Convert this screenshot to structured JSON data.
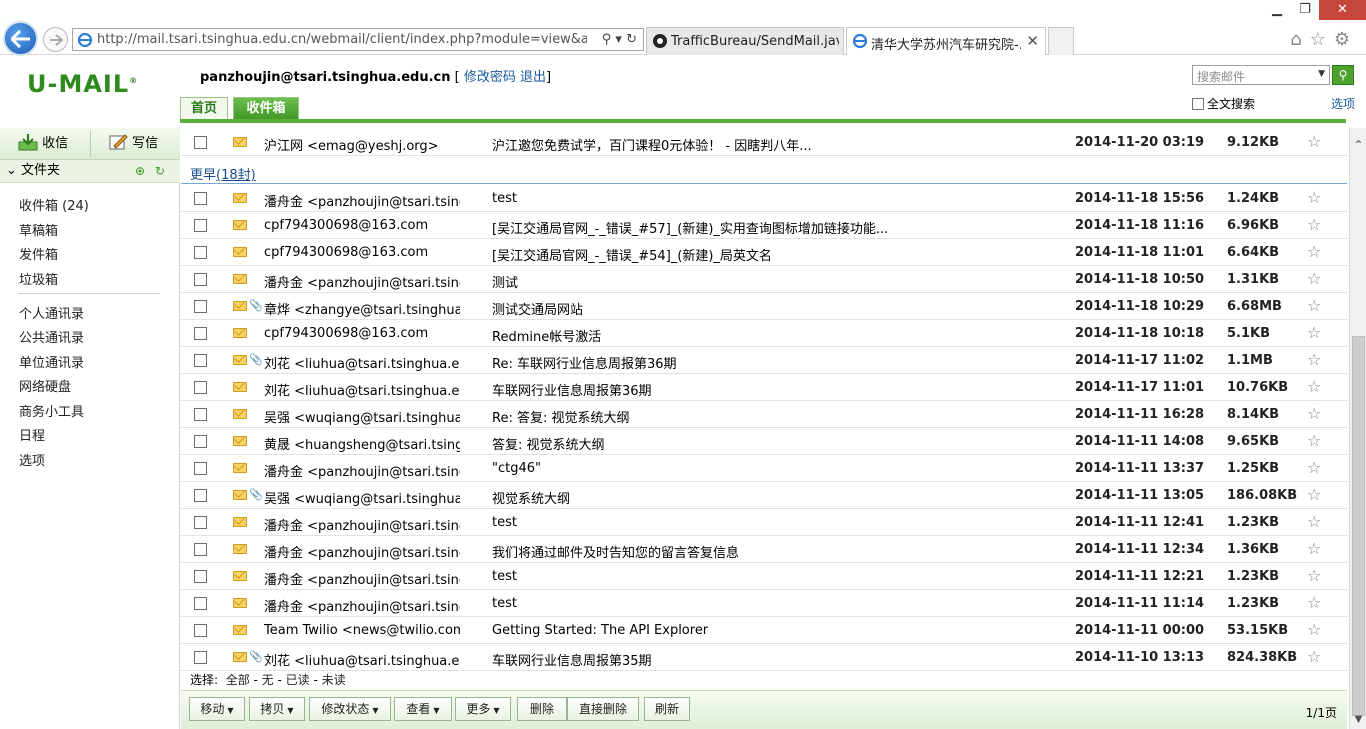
{
  "browser": {
    "url": "http://mail.tsari.tsinghua.edu.cn/webmail/client/index.php?module=view&action=ir",
    "tabs": [
      {
        "label": "TrafficBureau/SendMail.jav..."
      },
      {
        "label": "清华大学苏州汽车研究院-..."
      }
    ]
  },
  "header": {
    "logo": "U-MAIL",
    "user_email": "panzhoujin@tsari.tsinghua.edu.cn",
    "change_password": "修改密码",
    "logout": "退出",
    "tabs": {
      "home": "首页",
      "inbox": "收件箱"
    },
    "search_placeholder": "搜索邮件",
    "fulltext_label": "全文搜索",
    "options_link": "选项"
  },
  "sidebar": {
    "receive": "收信",
    "write": "写信",
    "folders_title": "文件夹",
    "folders": [
      "收件箱 (24)",
      "草稿箱",
      "发件箱",
      "垃圾箱"
    ],
    "tools": [
      "个人通讯录",
      "公共通讯录",
      "单位通讯录",
      "网络硬盘",
      "商务小工具",
      "日程",
      "选项"
    ]
  },
  "list": {
    "top_row": {
      "from": "沪江网 <emag@yeshj.org>",
      "subject": "沪江邀您免费试学，百门课程0元体验！ - 因瞎判八年...",
      "date": "2014-11-20 03:19",
      "size": "9.12KB"
    },
    "group_label": "更早",
    "group_count": "(18封)",
    "rows": [
      {
        "from": "潘舟金 <panzhoujin@tsari.tsinghua",
        "subject": "test",
        "date": "2014-11-18 15:56",
        "size": "1.24KB",
        "attach": false
      },
      {
        "from": "cpf794300698@163.com",
        "subject": "[吴江交通局官网_-_错误_#57]_(新建)_实用查询图标增加链接功能...",
        "date": "2014-11-18 11:16",
        "size": "6.96KB",
        "attach": false
      },
      {
        "from": "cpf794300698@163.com",
        "subject": "[吴江交通局官网_-_错误_#54]_(新建)_局英文名",
        "date": "2014-11-18 11:01",
        "size": "6.64KB",
        "attach": false
      },
      {
        "from": "潘舟金 <panzhoujin@tsari.tsinghua",
        "subject": "测试",
        "date": "2014-11-18 10:50",
        "size": "1.31KB",
        "attach": false
      },
      {
        "from": "章烨 <zhangye@tsari.tsinghua.edu",
        "subject": "测试交通局网站",
        "date": "2014-11-18 10:29",
        "size": "6.68MB",
        "attach": true
      },
      {
        "from": "cpf794300698@163.com",
        "subject": "Redmine帐号激活",
        "date": "2014-11-18 10:18",
        "size": "5.1KB",
        "attach": false
      },
      {
        "from": "刘花 <liuhua@tsari.tsinghua.edu",
        "subject": "Re: 车联网行业信息周报第36期",
        "date": "2014-11-17 11:02",
        "size": "1.1MB",
        "attach": true
      },
      {
        "from": "刘花 <liuhua@tsari.tsinghua.edu",
        "subject": "车联网行业信息周报第36期",
        "date": "2014-11-17 11:01",
        "size": "10.76KB",
        "attach": false
      },
      {
        "from": "吴强 <wuqiang@tsari.tsinghua.e",
        "subject": "Re: 答复: 视觉系统大纲",
        "date": "2014-11-11 16:28",
        "size": "8.14KB",
        "attach": false
      },
      {
        "from": "黄晟 <huangsheng@tsari.tsinghu",
        "subject": "答复: 视觉系统大纲",
        "date": "2014-11-11 14:08",
        "size": "9.65KB",
        "attach": false
      },
      {
        "from": "潘舟金 <panzhoujin@tsari.tsinghua",
        "subject": "\"ctg46\"",
        "date": "2014-11-11 13:37",
        "size": "1.25KB",
        "attach": false
      },
      {
        "from": "吴强 <wuqiang@tsari.tsinghua.e",
        "subject": "视觉系统大纲",
        "date": "2014-11-11 13:05",
        "size": "186.08KB",
        "attach": true
      },
      {
        "from": "潘舟金 <panzhoujin@tsari.tsinghua",
        "subject": "test",
        "date": "2014-11-11 12:41",
        "size": "1.23KB",
        "attach": false
      },
      {
        "from": "潘舟金 <panzhoujin@tsari.tsinghua",
        "subject": "我们将通过邮件及时告知您的留言答复信息",
        "date": "2014-11-11 12:34",
        "size": "1.36KB",
        "attach": false
      },
      {
        "from": "潘舟金 <panzhoujin@tsari.tsinghua",
        "subject": "test",
        "date": "2014-11-11 12:21",
        "size": "1.23KB",
        "attach": false
      },
      {
        "from": "潘舟金 <panzhoujin@tsari.tsinghua",
        "subject": "test",
        "date": "2014-11-11 11:14",
        "size": "1.23KB",
        "attach": false
      },
      {
        "from": "Team Twilio <news@twilio.com>",
        "subject": "Getting Started: The API Explorer",
        "date": "2014-11-11 00:00",
        "size": "53.15KB",
        "attach": false
      },
      {
        "from": "刘花 <liuhua@tsari.tsinghua.edu",
        "subject": "车联网行业信息周报第35期",
        "date": "2014-11-10 13:13",
        "size": "824.38KB",
        "attach": true
      }
    ]
  },
  "selection": {
    "label": "选择:",
    "all": "全部",
    "none": "无",
    "read": "已读",
    "unread": "未读"
  },
  "toolbar": {
    "move": "移动",
    "copy": "拷贝",
    "status": "修改状态",
    "view": "查看",
    "more": "更多",
    "delete": "删除",
    "delete_direct": "直接删除",
    "refresh": "刷新",
    "page": "1/1页"
  }
}
